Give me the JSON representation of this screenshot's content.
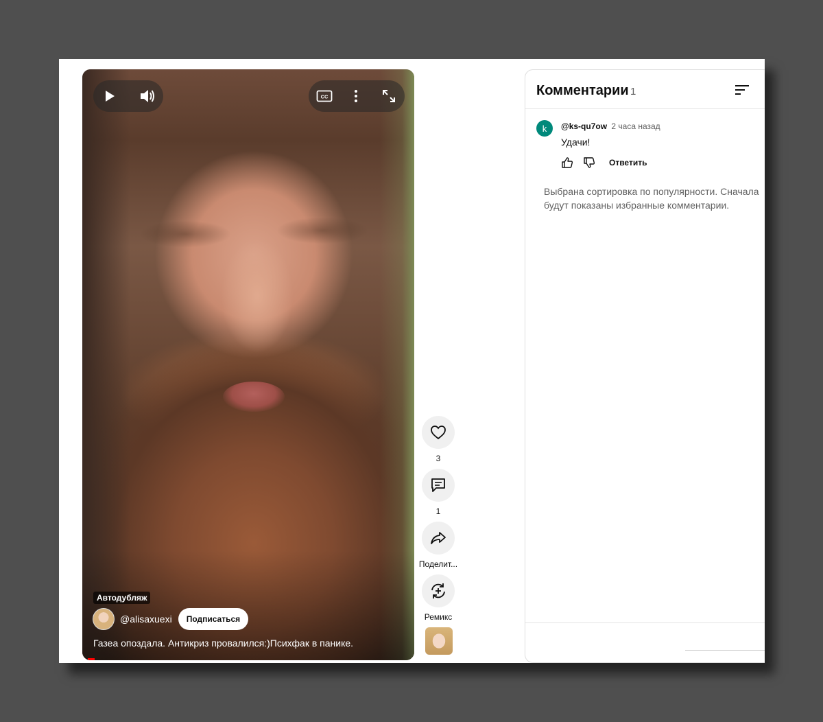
{
  "video": {
    "autodub_label": "Автодубляж",
    "channel_handle": "@alisaxuexi",
    "subscribe_label": "Подписаться",
    "title": "Газеа опоздала. Антикриз провалился:)Психфак в панике."
  },
  "actions": {
    "likes_count": "3",
    "comments_count": "1",
    "share_label": "Поделит...",
    "remix_label": "Ремикс"
  },
  "comments": {
    "title": "Комментарии",
    "count": "1",
    "items": [
      {
        "avatar_letter": "k",
        "avatar_color": "#00897b",
        "author": "@ks-qu7ow",
        "time": "2 часа назад",
        "text": "Удачи!",
        "reply_label": "Ответить"
      }
    ],
    "sort_note": "Выбрана сортировка по популярности. Сначала будут показаны избранные комментарии."
  }
}
